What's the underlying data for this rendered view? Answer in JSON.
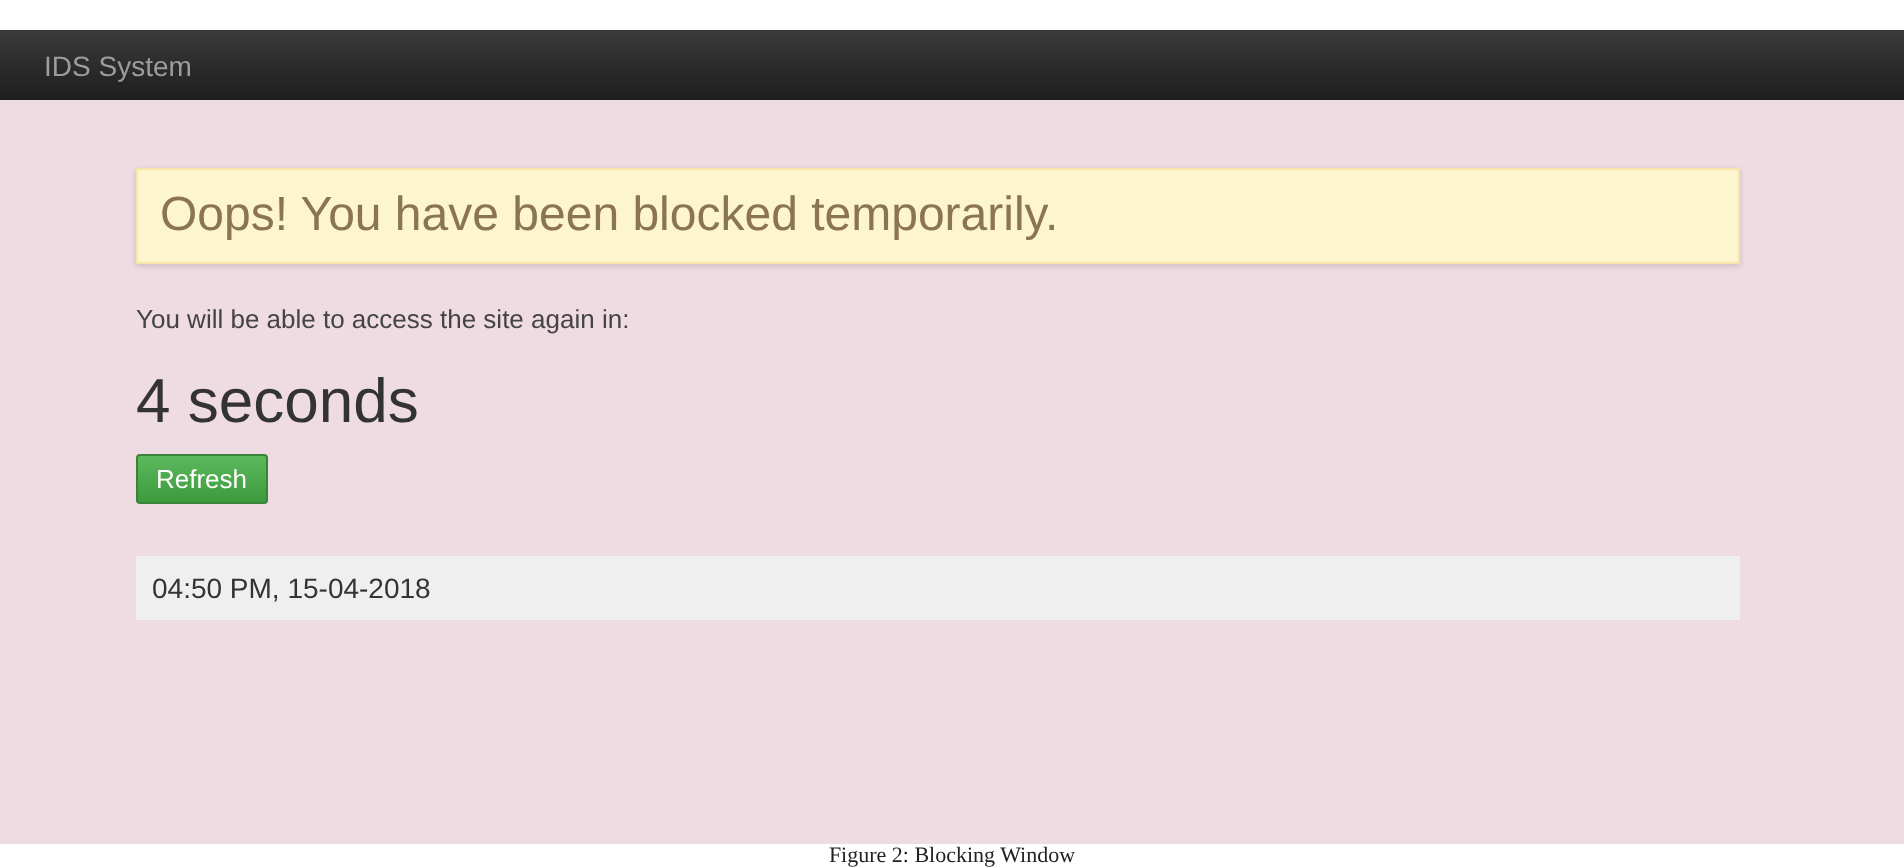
{
  "navbar": {
    "brand": "IDS System"
  },
  "alert": {
    "text": "Oops! You have been blocked temporarily."
  },
  "message": "You will be able to access the site again in:",
  "countdown": "4 seconds",
  "buttons": [
    {
      "label": "Refresh"
    }
  ],
  "timestamp": "04:50 PM, 15-04-2018",
  "caption": "Figure 2: Blocking Window"
}
